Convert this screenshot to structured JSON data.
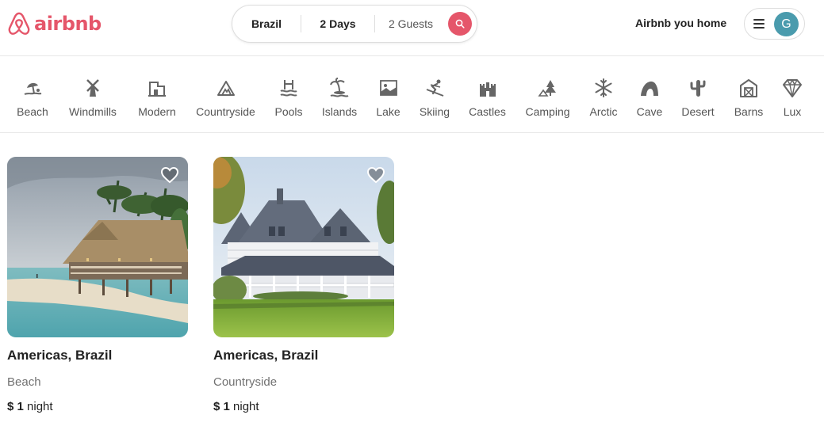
{
  "header": {
    "logo_text": "airbnb",
    "search": {
      "place": "Brazil",
      "days": "2 Days",
      "guests": "2 Guests"
    },
    "host_link": "Airbnb you home",
    "avatar_initial": "G"
  },
  "categories": [
    {
      "label": "Beach",
      "icon": "beach-icon"
    },
    {
      "label": "Windmills",
      "icon": "windmill-icon"
    },
    {
      "label": "Modern",
      "icon": "modern-house-icon"
    },
    {
      "label": "Countryside",
      "icon": "mountain-icon"
    },
    {
      "label": "Pools",
      "icon": "pool-icon"
    },
    {
      "label": "Islands",
      "icon": "island-icon"
    },
    {
      "label": "Lake",
      "icon": "lake-icon"
    },
    {
      "label": "Skiing",
      "icon": "skiing-icon"
    },
    {
      "label": "Castles",
      "icon": "castle-icon"
    },
    {
      "label": "Camping",
      "icon": "camping-icon"
    },
    {
      "label": "Arctic",
      "icon": "snowflake-icon"
    },
    {
      "label": "Cave",
      "icon": "cave-icon"
    },
    {
      "label": "Desert",
      "icon": "cactus-icon"
    },
    {
      "label": "Barns",
      "icon": "barn-icon"
    },
    {
      "label": "Lux",
      "icon": "diamond-icon"
    }
  ],
  "listings": [
    {
      "title": "Americas, Brazil",
      "category": "Beach",
      "price_symbol": "$",
      "price": "1",
      "price_unit": "night"
    },
    {
      "title": "Americas, Brazil",
      "category": "Countryside",
      "price_symbol": "$",
      "price": "1",
      "price_unit": "night"
    }
  ],
  "colors": {
    "brand": "#e5566a",
    "avatar": "#4a9bad",
    "muted_text": "#717171"
  }
}
